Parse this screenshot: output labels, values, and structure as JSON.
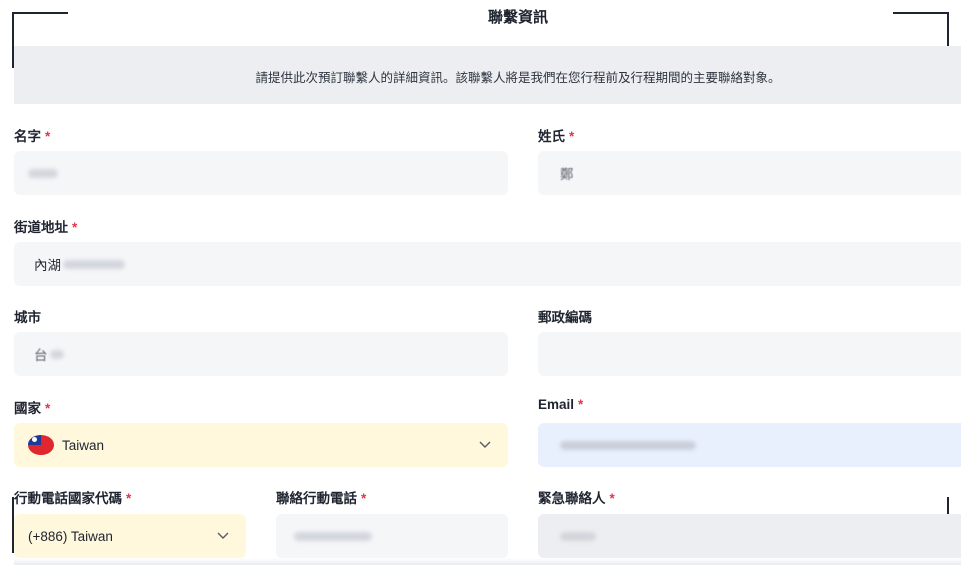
{
  "header": {
    "title": "聯繫資訊",
    "notice": "請提供此次預訂聯繫人的詳細資訊。該聯繫人將是我們在您行程前及行程期間的主要聯絡對象。"
  },
  "required_mark": "*",
  "fields": {
    "first_name": {
      "label": "名字",
      "required": true,
      "value_visible": ""
    },
    "last_name": {
      "label": "姓氏",
      "required": true,
      "value_visible": "鄭"
    },
    "street": {
      "label": "街道地址",
      "required": true,
      "value_visible": "內湖"
    },
    "city": {
      "label": "城市",
      "required": false,
      "value_visible": "台"
    },
    "postal": {
      "label": "郵政編碼",
      "required": false,
      "value_visible": ""
    },
    "country": {
      "label": "國家",
      "required": true,
      "value": "Taiwan"
    },
    "email": {
      "label": "Email",
      "required": true,
      "value_visible": ""
    },
    "phone_code": {
      "label": "行動電話國家代碼",
      "required": true,
      "value": "(+886) Taiwan"
    },
    "phone": {
      "label": "聯絡行動電話",
      "required": true,
      "value_visible": ""
    },
    "emergency": {
      "label": "緊急聯絡人",
      "required": true,
      "value_visible": ""
    }
  },
  "colors": {
    "required": "#e0364e",
    "select_bg": "#fff8dc",
    "email_bg": "#e8f0fe",
    "input_bg": "#f5f6f8",
    "banner_bg": "#eceef1"
  },
  "icons": {
    "dropdown": "chevron-down-icon",
    "country_flag": "taiwan-flag-icon"
  }
}
